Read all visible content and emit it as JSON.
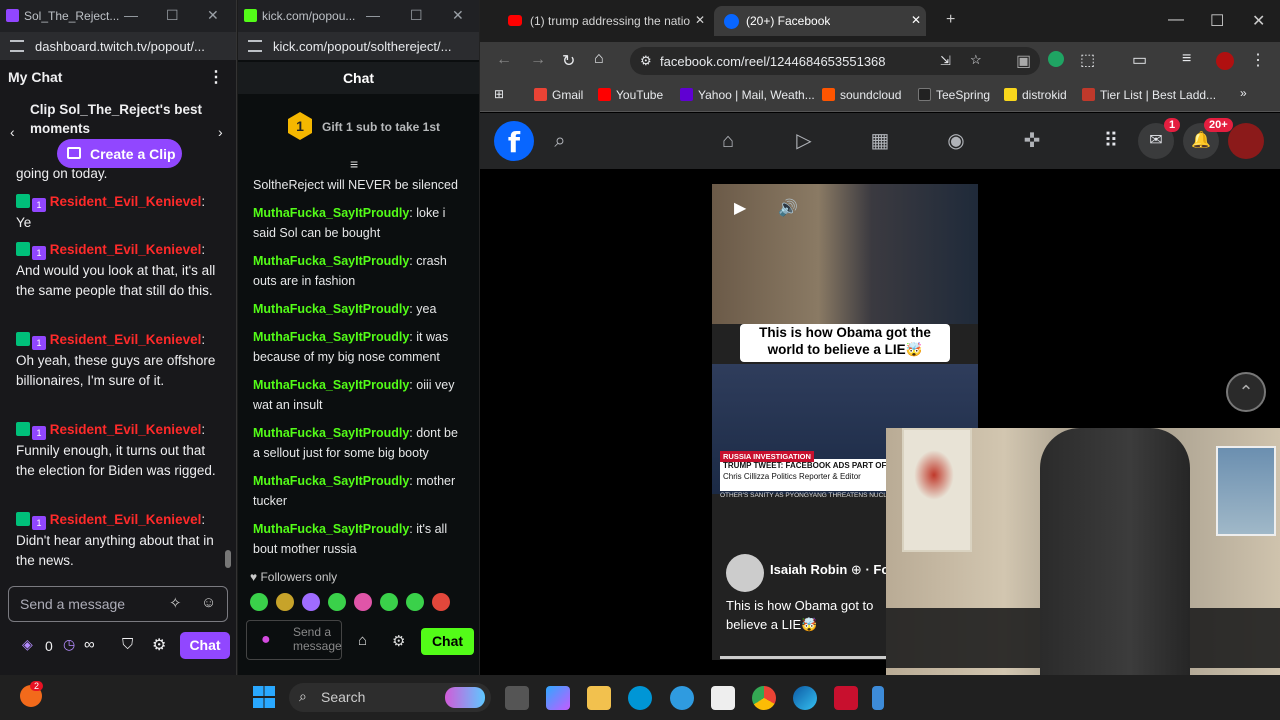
{
  "twitch_window": {
    "tab_title": "Sol_The_Reject...",
    "url": "dashboard.twitch.tv/popout/...",
    "header": "My Chat",
    "clip_banner": "Clip Sol_The_Reject's best moments",
    "clip_button": "Create a Clip",
    "partial_top": "going on today.",
    "messages": [
      {
        "user": "Resident_Evil_Kenievel",
        "text": "Ye"
      },
      {
        "user": "Resident_Evil_Kenievel",
        "text": "And would you look at that, it's all the same people that still do this."
      },
      {
        "user": "Resident_Evil_Kenievel",
        "text": "Oh yeah, these guys are offshore billionaires, I'm sure of it."
      },
      {
        "user": "Resident_Evil_Kenievel",
        "text": "Funnily enough, it turns out that the election for Biden was rigged."
      },
      {
        "user": "Resident_Evil_Kenievel",
        "text": "Didn't hear anything about that in the news."
      }
    ],
    "input_placeholder": "Send a message",
    "points": "0",
    "infinity": "∞",
    "chat_button": "Chat"
  },
  "kick_window": {
    "tab_title": "kick.com/popou...",
    "url": "kick.com/popout/solthereject/...",
    "header": "Chat",
    "gift_count": "1",
    "gift_text": "Gift 1 sub to take 1st",
    "pinned": "SoltheReject will NEVER be silenced",
    "messages": [
      {
        "user": "MuthaFucka_SayItProudly",
        "text": "loke i said Sol can be bought"
      },
      {
        "user": "MuthaFucka_SayItProudly",
        "text": "crash outs are in fashion"
      },
      {
        "user": "MuthaFucka_SayItProudly",
        "text": "yea"
      },
      {
        "user": "MuthaFucka_SayItProudly",
        "text": "it was because of my big nose comment"
      },
      {
        "user": "MuthaFucka_SayItProudly",
        "text": "oiii vey wat an insult"
      },
      {
        "user": "MuthaFucka_SayItProudly",
        "text": "dont be a sellout just for some big booty"
      },
      {
        "user": "MuthaFucka_SayItProudly",
        "text": "mother tucker"
      },
      {
        "user": "MuthaFucka_SayItProudly",
        "text": "it's all bout mother russia"
      }
    ],
    "followers_only": "Followers only",
    "input_placeholder": "Send a message",
    "chat_button": "Chat"
  },
  "facebook_window": {
    "tabs": [
      {
        "title": "(1) trump addressing the natio"
      },
      {
        "title": "(20+) Facebook"
      }
    ],
    "url": "facebook.com/reel/1244684653551368",
    "bookmarks": [
      {
        "label": "Gmail",
        "color": "#ea4335"
      },
      {
        "label": "YouTube",
        "color": "#ff0000"
      },
      {
        "label": "Yahoo | Mail, Weath...",
        "color": "#6001d2"
      },
      {
        "label": "soundcloud",
        "color": "#ff5500"
      },
      {
        "label": "TeeSpring",
        "color": "#222222"
      },
      {
        "label": "distrokid",
        "color": "#f9d71c"
      },
      {
        "label": "Tier List | Best Ladd...",
        "color": "#c0392b"
      }
    ],
    "messenger_badge": "1",
    "notif_badge": "20+",
    "reel_caption": "This is how Obama got the world to believe a LIE🤯",
    "news_tag": "RUSSIA INVESTIGATION",
    "news_headline": "TRUMP TWEET: FACEBOOK ADS PART OF",
    "news_name": "Chris Cillizza",
    "news_sub": "Politics Reporter & Editor",
    "news_ticker": "OTHER'S SANITY AS PYONGYANG THREATENS NUCLEAR TE",
    "author": "Isaiah Robin",
    "author_suffix": "· Fo",
    "description": "This is how Obama got to believe a LIE🤯"
  },
  "taskbar": {
    "search_placeholder": "Search",
    "notification_count": "2"
  }
}
